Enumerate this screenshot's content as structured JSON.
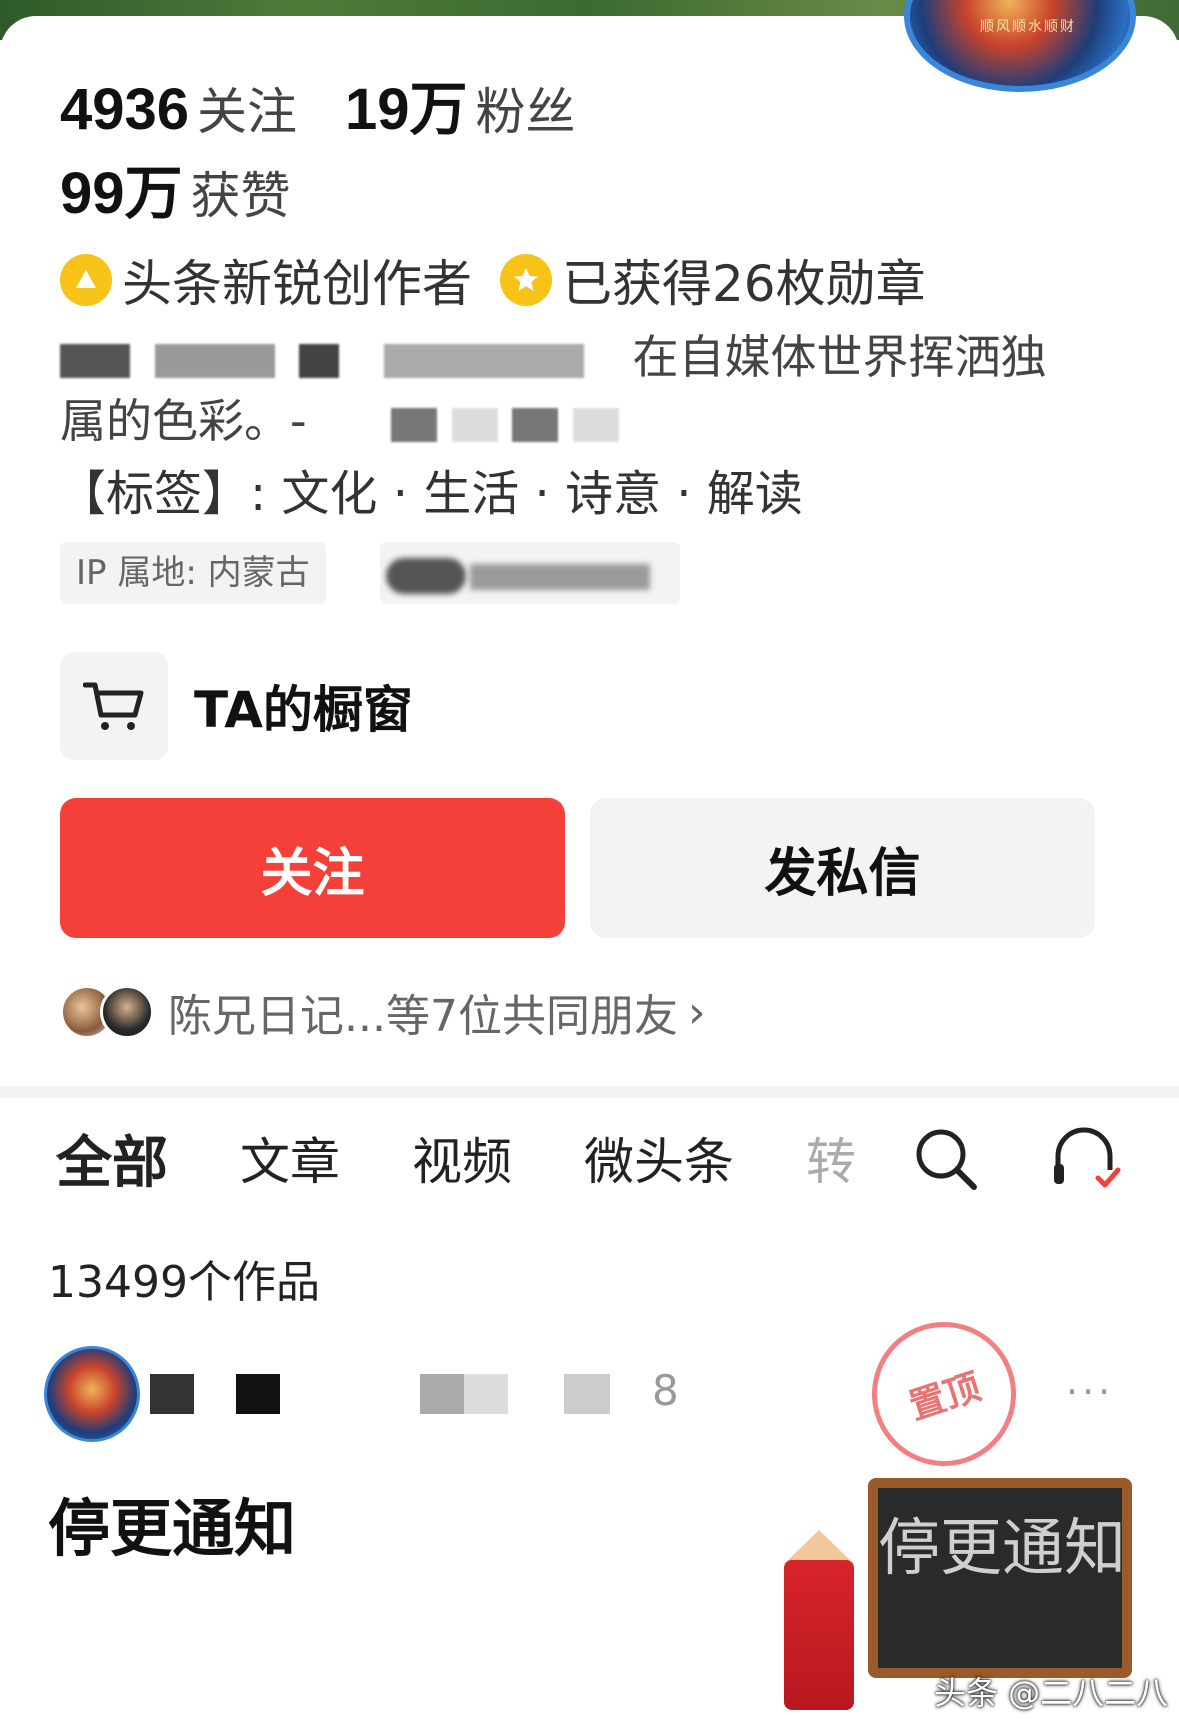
{
  "header": {
    "avatar_text": "顺风顺水顺财"
  },
  "stats": {
    "following_num": "4936",
    "following_label": "关注",
    "fans_num": "19万",
    "fans_label": "粉丝",
    "likes_num": "99万",
    "likes_label": "获赞"
  },
  "badges": [
    {
      "icon": "creator-badge-icon",
      "text": "头条新锐创作者"
    },
    {
      "icon": "medal-icon",
      "text": "已获得26枚勋章"
    }
  ],
  "bio": {
    "line1_visible": "在自媒体世界挥洒独",
    "line2_visible": "属的色彩。-",
    "tags": "【标签】: 文化 · 生活 · 诗意 · 解读"
  },
  "ip_location": "IP 属地: 内蒙古",
  "shop": {
    "label": "TA的橱窗",
    "icon": "cart-icon"
  },
  "actions": {
    "follow": "关注",
    "message": "发私信"
  },
  "friends": {
    "text": "陈兄日记...等7位共同朋友",
    "chevron": "›"
  },
  "tabs": [
    {
      "label": "全部",
      "active": true
    },
    {
      "label": "文章",
      "active": false
    },
    {
      "label": "视频",
      "active": false
    },
    {
      "label": "微头条",
      "active": false
    },
    {
      "label": "转",
      "active": false
    }
  ],
  "works_count": "13499个作品",
  "post": {
    "num_fragment": "8",
    "stamp": "置顶",
    "more": "···",
    "title": "停更通知",
    "board_text": "停更通知"
  },
  "watermark": "头条 @二八二八",
  "colors": {
    "accent": "#f5403a",
    "badge_yellow": "#f7c318"
  }
}
